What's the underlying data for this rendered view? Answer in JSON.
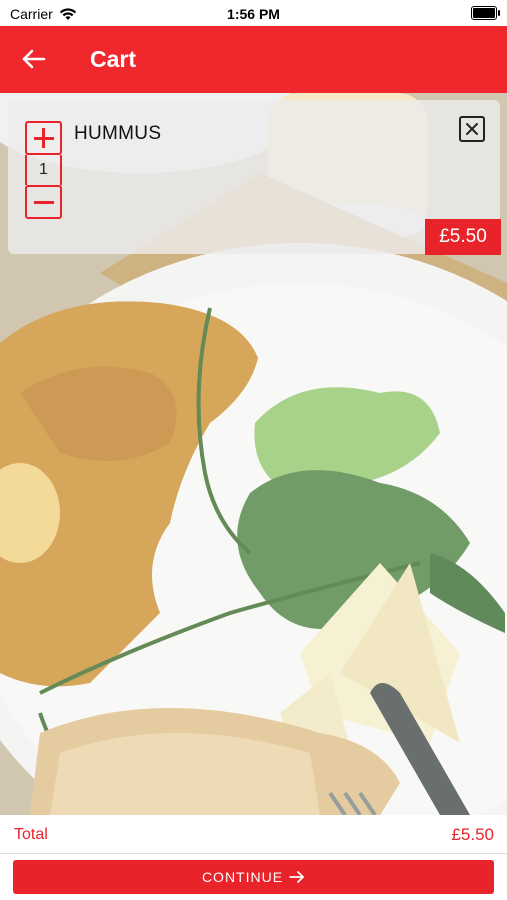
{
  "status_bar": {
    "carrier": "Carrier",
    "time": "1:56 PM"
  },
  "header": {
    "title": "Cart",
    "back_icon": "arrow-left-icon"
  },
  "cart": {
    "items": [
      {
        "name": "HUMMUS",
        "quantity": "1",
        "price": "£5.50"
      }
    ]
  },
  "footer": {
    "total_label": "Total",
    "total_value": "£5.50",
    "continue_label": "CONTINUE"
  },
  "colors": {
    "accent": "#f0282d",
    "button": "#e8232a",
    "text": "#111111"
  }
}
